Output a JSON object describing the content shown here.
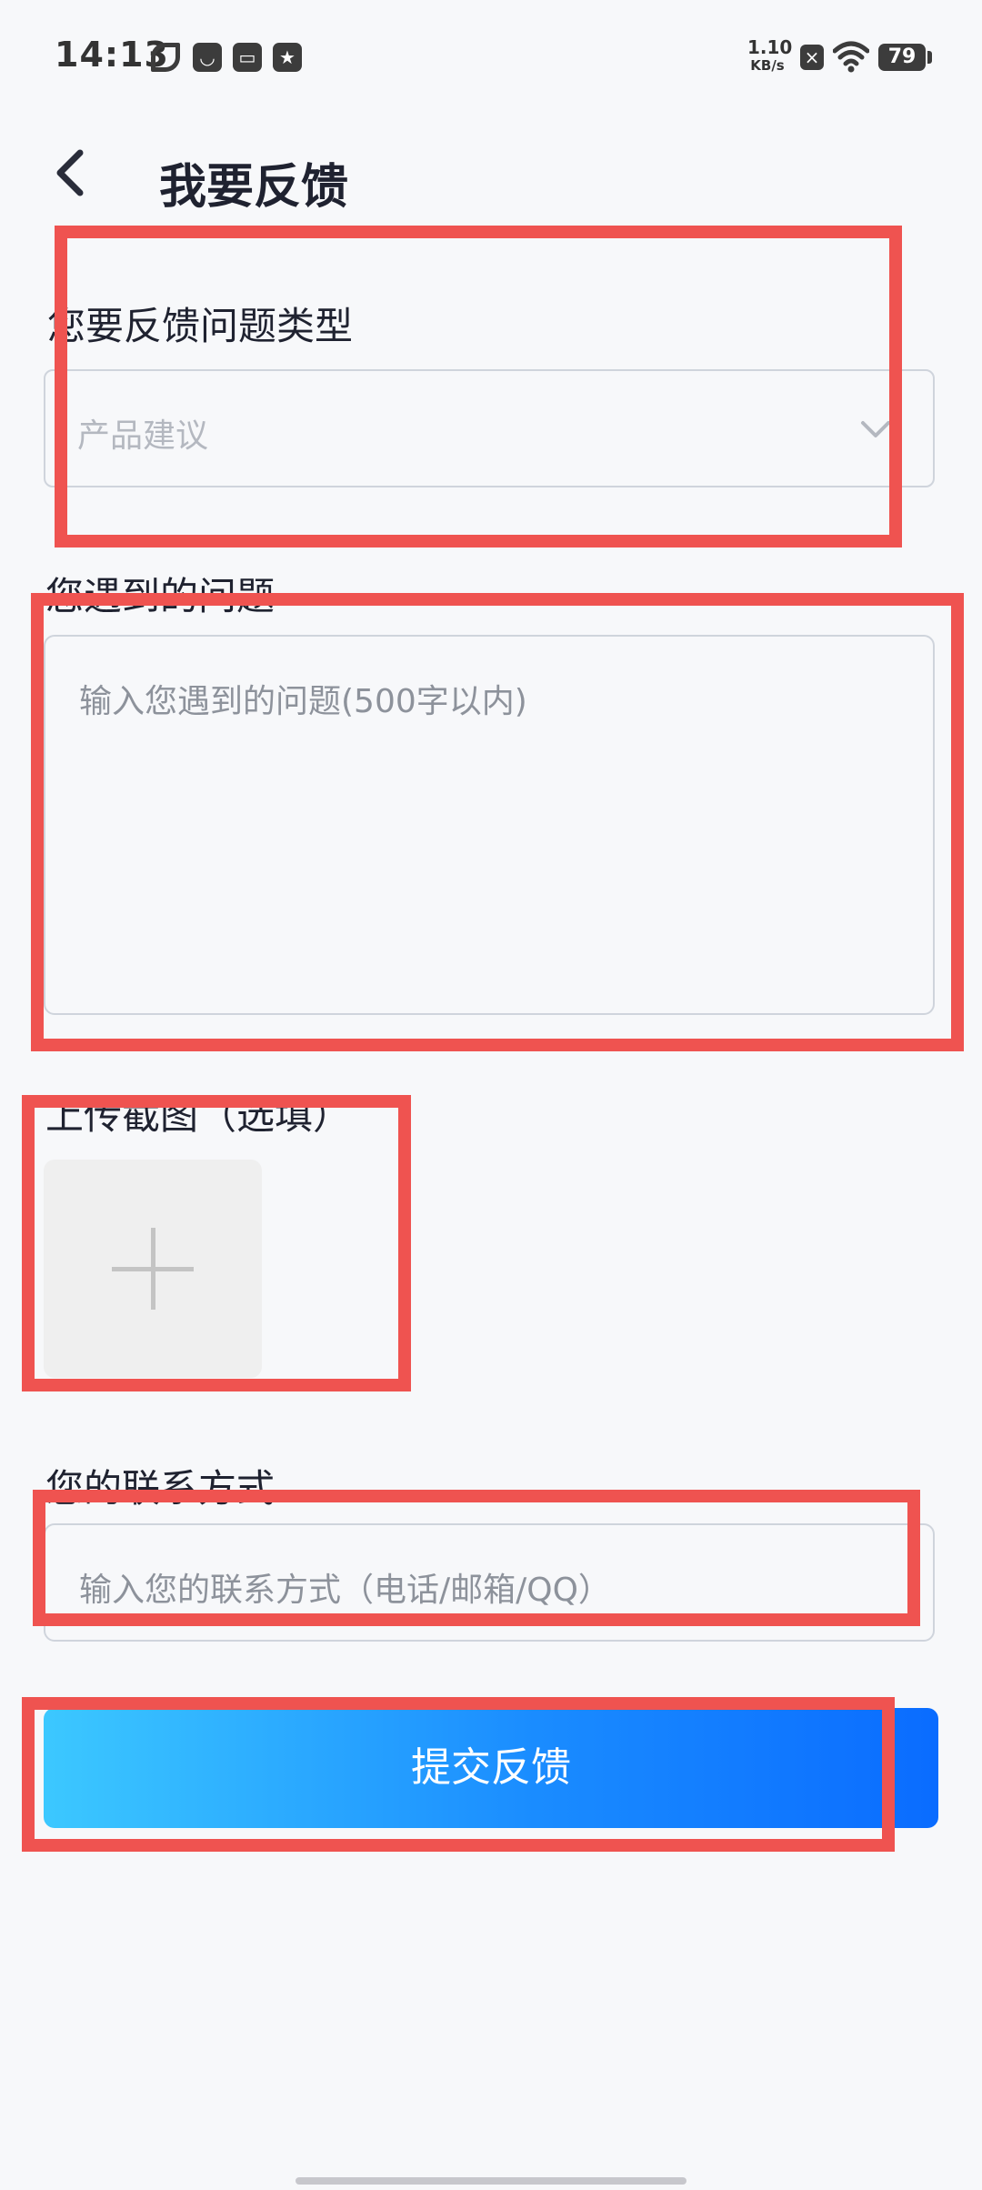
{
  "status_bar": {
    "time": "14:13",
    "net_speed_value": "1.10",
    "net_speed_unit": "KB/s",
    "battery": "79",
    "icons": [
      "leaf-icon",
      "message-icon",
      "calendar-icon",
      "star-icon",
      "close-notification-icon",
      "wifi-icon",
      "battery-icon"
    ]
  },
  "header": {
    "title": "我要反馈",
    "back_icon": "chevron-left-icon"
  },
  "form": {
    "type_label": "您要反馈问题类型",
    "type_value": "产品建议",
    "problem_label": "您遇到的问题",
    "problem_placeholder": "输入您遇到的问题(500字以内)",
    "upload_label": "上传截图（选填）",
    "contact_label": "您的联系方式",
    "contact_placeholder": "输入您的联系方式（电话/邮箱/QQ）",
    "submit_label": "提交反馈"
  },
  "colors": {
    "annotation": "#ef5350",
    "button_gradient_start": "#3cc8ff",
    "button_gradient_end": "#0a6cff",
    "background": "#f7f8fa"
  }
}
